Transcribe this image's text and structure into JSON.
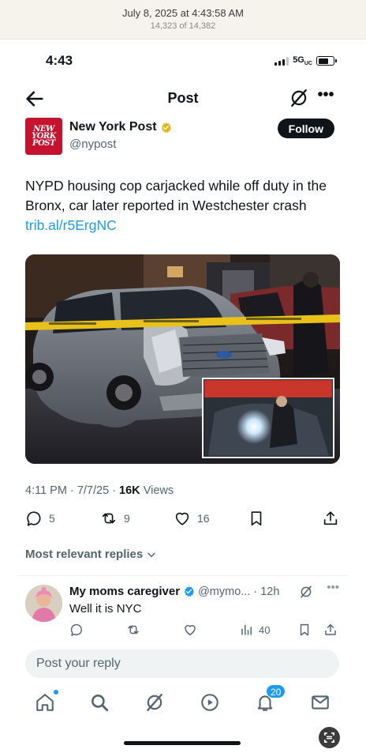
{
  "photo_viewer": {
    "date": "July 8, 2025 at 4:43:58 AM",
    "count": "14,323 of 14,382"
  },
  "status_bar": {
    "time": "4:43",
    "network": "5G",
    "network_suffix": "UC",
    "battery_level": 0.7
  },
  "nav": {
    "title": "Post",
    "more": "•••"
  },
  "author": {
    "logo_lines": [
      "NEW",
      "YORK",
      "POST"
    ],
    "name": "New York Post",
    "handle": "@nypost",
    "verified": "gold",
    "follow_label": "Follow"
  },
  "post": {
    "text": "NYPD housing cop carjacked while off duty in the Bronx, car later reported in Westchester crash",
    "link": "trib.al/r5ErgNC",
    "time": "4:11 PM",
    "date": "7/7/25",
    "views_count": "16K",
    "views_label": "Views",
    "image": "crashed-suv-police-tape-photo"
  },
  "actions": {
    "replies": "5",
    "reposts": "9",
    "likes": "16"
  },
  "replies_filter": "Most relevant replies",
  "reply": {
    "name": "My moms caregiver",
    "handle": "@mymo...",
    "time": "12h",
    "text": "Well it is NYC",
    "views": "40",
    "verified": "blue"
  },
  "compose": {
    "placeholder": "Post your reply"
  },
  "tabbar": {
    "notification_count": "20"
  },
  "colors": {
    "accent": "#1d9bf0",
    "text": "#0f1419",
    "secondary": "#536471",
    "brand": "#c4122f",
    "gold": "#e2b719"
  }
}
